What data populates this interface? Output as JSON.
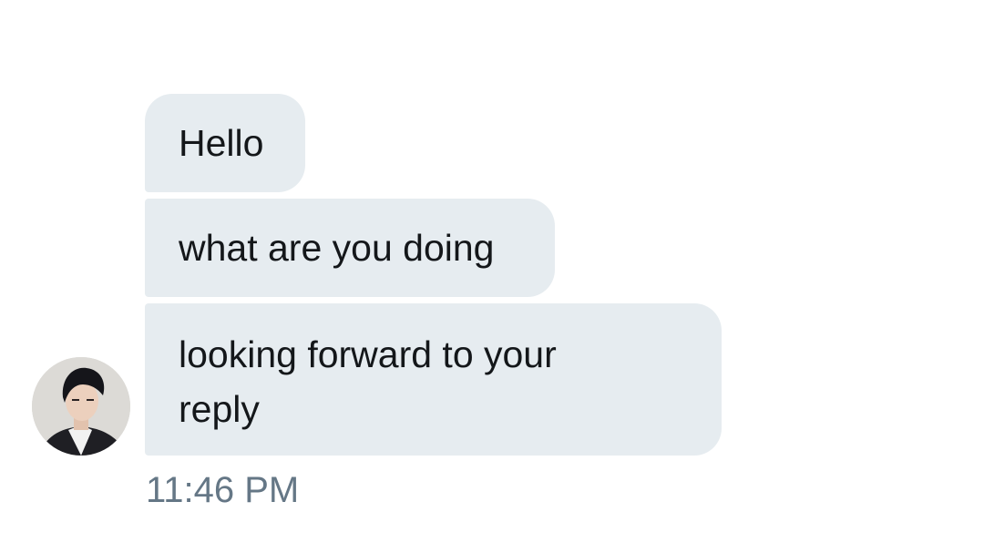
{
  "conversation": {
    "messages": [
      {
        "text": "Hello"
      },
      {
        "text": "what are you doing"
      },
      {
        "text": "looking forward to your reply"
      }
    ],
    "timestamp": "11:46 PM",
    "avatar_icon": "person-avatar-icon"
  },
  "colors": {
    "bubble_background": "#e6ecf0",
    "message_text": "#14171a",
    "timestamp_text": "#657786",
    "background": "#ffffff"
  }
}
